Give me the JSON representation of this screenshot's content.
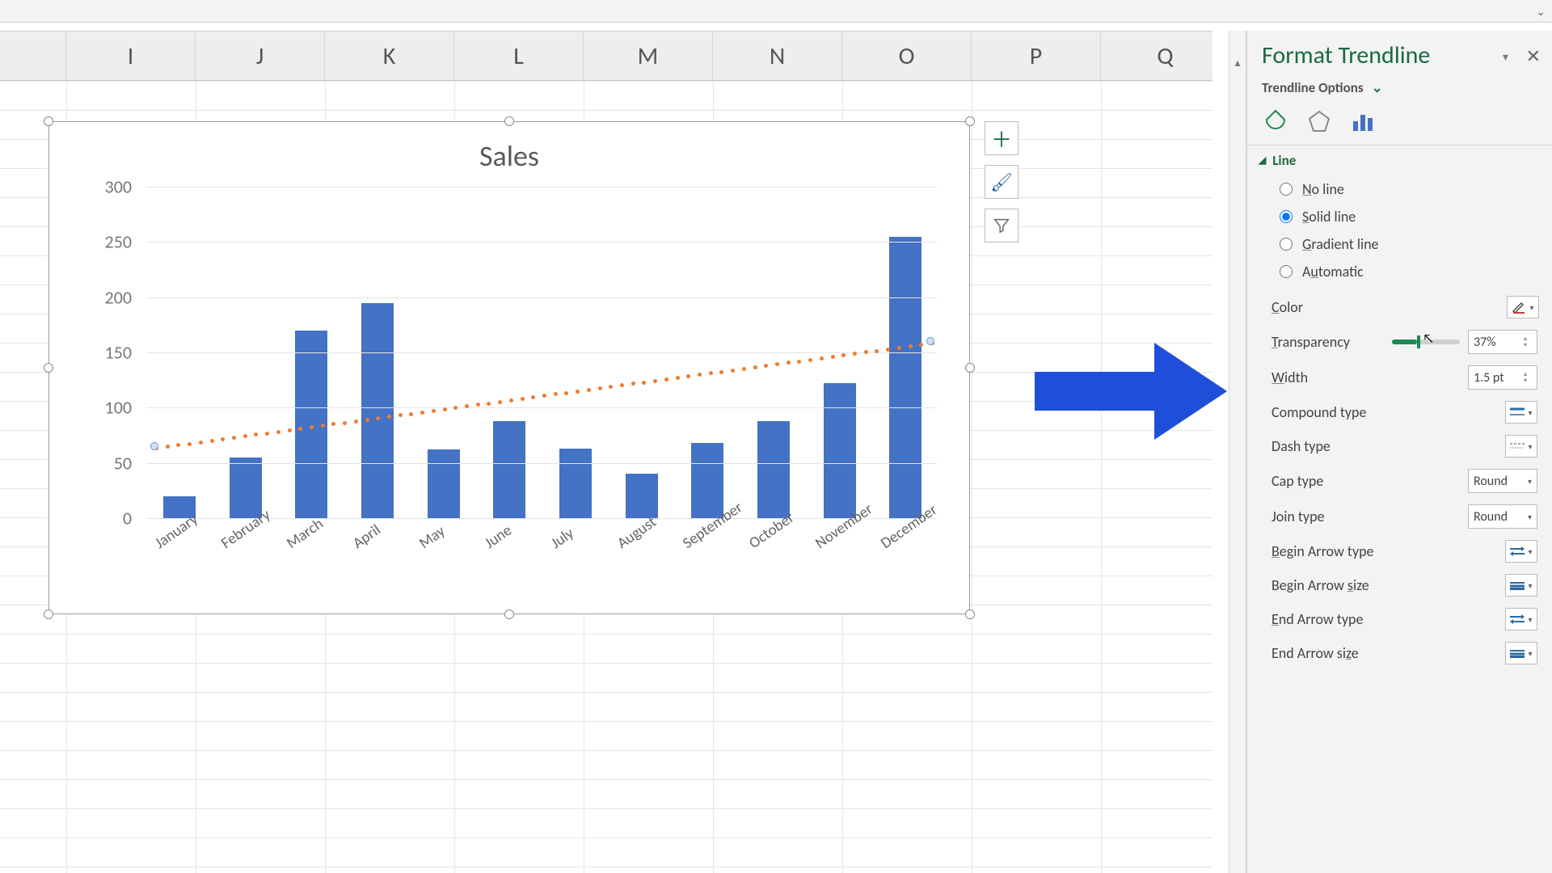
{
  "columns": [
    "I",
    "J",
    "K",
    "L",
    "M",
    "N",
    "O",
    "P",
    "Q"
  ],
  "chart_buttons": [
    "plus",
    "brush",
    "filter"
  ],
  "pane": {
    "title": "Format Trendline",
    "subtitle": "Trendline Options",
    "section": "Line",
    "radios": {
      "no_line": "No line",
      "solid_line": "Solid line",
      "gradient_line": "Gradient line",
      "automatic": "Automatic",
      "selected": "solid_line"
    },
    "color_label": "Color",
    "transparency_label": "Transparency",
    "transparency_value": "37%",
    "transparency_pct": 37,
    "width_label": "Width",
    "width_value": "1.5 pt",
    "compound_label": "Compound type",
    "dash_label": "Dash type",
    "cap_label": "Cap type",
    "cap_value": "Round",
    "join_label": "Join type",
    "join_value": "Round",
    "begin_arrow_type": "Begin Arrow type",
    "begin_arrow_size": "Begin Arrow size",
    "end_arrow_type": "End Arrow type",
    "end_arrow_size": "End Arrow size"
  },
  "chart_data": {
    "type": "bar",
    "title": "Sales",
    "categories": [
      "January",
      "February",
      "March",
      "April",
      "May",
      "June",
      "July",
      "August",
      "September",
      "October",
      "November",
      "December"
    ],
    "values": [
      20,
      55,
      170,
      195,
      62,
      88,
      63,
      40,
      68,
      88,
      122,
      255
    ],
    "ylim": [
      0,
      300
    ],
    "yticks": [
      0,
      50,
      100,
      150,
      200,
      250,
      300
    ],
    "xlabel": "",
    "ylabel": "",
    "trendline": {
      "start": 65,
      "end": 160,
      "style": "dotted",
      "color": "#ed7d31"
    }
  }
}
